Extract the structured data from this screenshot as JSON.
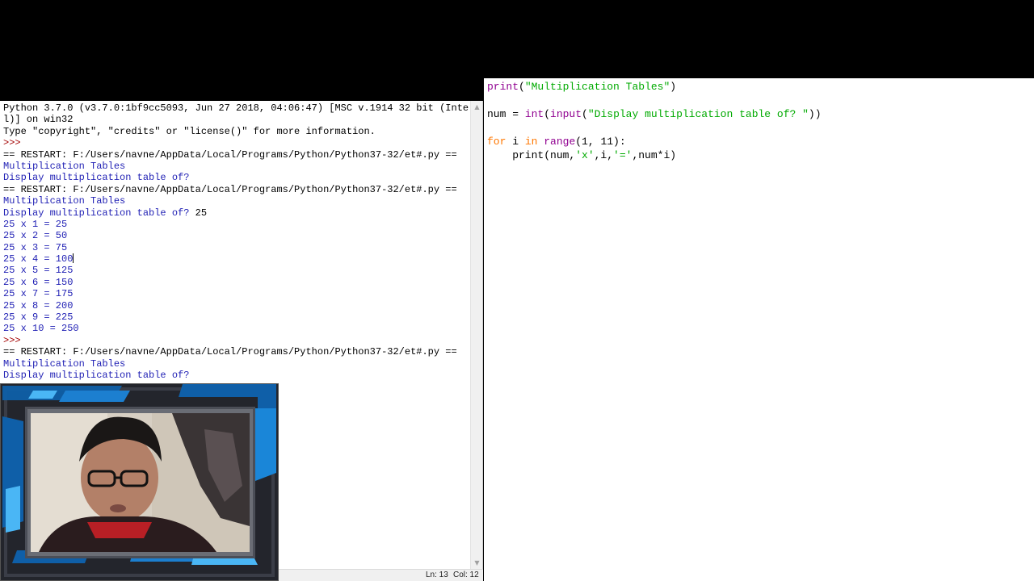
{
  "shell": {
    "lines": [
      {
        "text": "Python 3.7.0 (v3.7.0:1bf9cc5093, Jun 27 2018, 04:06:47) [MSC v.1914 32 bit (Inte",
        "style": "in"
      },
      {
        "text": "l)] on win32",
        "style": "in"
      },
      {
        "text": "Type \"copyright\", \"credits\" or \"license()\" for more information.",
        "style": "in"
      },
      {
        "text": ">>> ",
        "style": "prompt"
      },
      {
        "text": "== RESTART: F:/Users/navne/AppData/Local/Programs/Python/Python37-32/et#.py ==",
        "style": "in"
      },
      {
        "text": "Multiplication Tables",
        "style": "out"
      },
      {
        "text": "Display multiplication table of? ",
        "style": "out"
      },
      {
        "text": "== RESTART: F:/Users/navne/AppData/Local/Programs/Python/Python37-32/et#.py ==",
        "style": "in"
      },
      {
        "text": "Multiplication Tables",
        "style": "out"
      },
      {
        "text": "Display multiplication table of? ",
        "style": "out",
        "input": "25"
      },
      {
        "text": "25 x 1 = 25",
        "style": "out"
      },
      {
        "text": "25 x 2 = 50",
        "style": "out"
      },
      {
        "text": "25 x 3 = 75",
        "style": "out"
      },
      {
        "text": "25 x 4 = 100",
        "style": "out",
        "caret": true
      },
      {
        "text": "25 x 5 = 125",
        "style": "out"
      },
      {
        "text": "25 x 6 = 150",
        "style": "out"
      },
      {
        "text": "25 x 7 = 175",
        "style": "out"
      },
      {
        "text": "25 x 8 = 200",
        "style": "out"
      },
      {
        "text": "25 x 9 = 225",
        "style": "out"
      },
      {
        "text": "25 x 10 = 250",
        "style": "out"
      },
      {
        "text": ">>> ",
        "style": "prompt"
      },
      {
        "text": "== RESTART: F:/Users/navne/AppData/Local/Programs/Python/Python37-32/et#.py ==",
        "style": "in"
      },
      {
        "text": "Multiplication Tables",
        "style": "out"
      },
      {
        "text": "Display multiplication table of? ",
        "style": "out"
      }
    ]
  },
  "status": {
    "ln": "Ln: 13",
    "col": "Col: 12"
  },
  "editor": {
    "lines": [
      [
        {
          "t": "print",
          "k": "builtin"
        },
        {
          "t": "(",
          "k": "plain"
        },
        {
          "t": "\"Multiplication Tables\"",
          "k": "string"
        },
        {
          "t": ")",
          "k": "plain"
        }
      ],
      [],
      [
        {
          "t": "num = ",
          "k": "plain"
        },
        {
          "t": "int",
          "k": "builtin"
        },
        {
          "t": "(",
          "k": "plain"
        },
        {
          "t": "input",
          "k": "builtin"
        },
        {
          "t": "(",
          "k": "plain"
        },
        {
          "t": "\"Display multiplication table of? \"",
          "k": "string"
        },
        {
          "t": "))",
          "k": "plain"
        }
      ],
      [],
      [
        {
          "t": "for",
          "k": "keyword"
        },
        {
          "t": " i ",
          "k": "plain"
        },
        {
          "t": "in",
          "k": "keyword"
        },
        {
          "t": " ",
          "k": "plain"
        },
        {
          "t": "range",
          "k": "builtin"
        },
        {
          "t": "(1, 11):",
          "k": "plain"
        }
      ],
      [
        {
          "t": "    print(num,",
          "k": "plain"
        },
        {
          "t": "'x'",
          "k": "string"
        },
        {
          "t": ",i,",
          "k": "plain"
        },
        {
          "t": "'='",
          "k": "string"
        },
        {
          "t": ",num*i)",
          "k": "plain"
        }
      ]
    ]
  },
  "icons": {
    "scroll_up": "scroll-up-arrow-icon",
    "scroll_down": "scroll-down-arrow-icon"
  },
  "colors": {
    "shell_output": "#1f1fb4",
    "shell_prompt": "#a30000",
    "syntax_builtin": "#900090",
    "syntax_string": "#00aa00",
    "syntax_keyword": "#ff7700"
  }
}
